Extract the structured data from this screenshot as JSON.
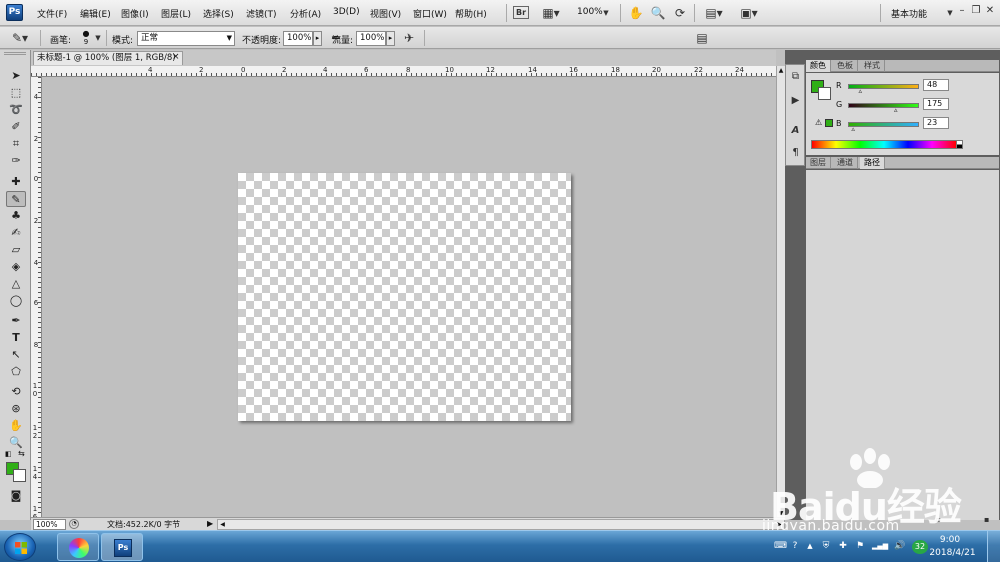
{
  "app": {
    "logo": "Ps"
  },
  "menu": [
    "文件(F)",
    "编辑(E)",
    "图像(I)",
    "图层(L)",
    "选择(S)",
    "滤镜(T)",
    "分析(A)",
    "3D(D)",
    "视图(V)",
    "窗口(W)",
    "帮助(H)"
  ],
  "appbar": {
    "zoom": "100%",
    "br_label": "Br",
    "workspace": "基本功能"
  },
  "options": {
    "brush_label": "画笔:",
    "brush_size": "9",
    "mode_label": "模式:",
    "mode_value": "正常",
    "opacity_label": "不透明度:",
    "opacity_value": "100%",
    "flow_label": "流量:",
    "flow_value": "100%"
  },
  "document": {
    "tab_title": "未标题-1 @ 100% (图层 1, RGB/8)",
    "tab_close": "×",
    "zoom": "100%",
    "doc_info": "文档:452.2K/0 字节"
  },
  "rulers": {
    "top": [
      "4",
      "2",
      "0",
      "2",
      "4",
      "6",
      "8",
      "10",
      "12",
      "14",
      "16",
      "18",
      "20",
      "22",
      "24"
    ],
    "left": [
      "4",
      "2",
      "0",
      "2",
      "4",
      "6",
      "8",
      "1 0",
      "1 2",
      "1 4",
      "1 6"
    ]
  },
  "color_panel": {
    "tabs": [
      "颜色",
      "色板",
      "样式"
    ],
    "channels": [
      {
        "label": "R",
        "value": "48",
        "fraction": 0.19
      },
      {
        "label": "G",
        "value": "175",
        "fraction": 0.69
      },
      {
        "label": "B",
        "value": "23",
        "fraction": 0.09
      }
    ],
    "foreground": "#30af17",
    "background": "#ffffff"
  },
  "layers_panel": {
    "tabs": [
      "图层",
      "通道",
      "路径"
    ]
  },
  "watermark": {
    "logo": "Baidu经验",
    "url": "jingyan.baidu.com"
  },
  "taskbar": {
    "ps_label": "Ps",
    "time": "9:00",
    "date": "2018/4/21",
    "badge": "32"
  },
  "icons": {
    "tools": [
      "move-icon",
      "marquee-icon",
      "lasso-icon",
      "quick-select-icon",
      "crop-icon",
      "eyedropper-icon",
      "spot-heal-icon",
      "brush-icon",
      "clone-stamp-icon",
      "history-brush-icon",
      "eraser-icon",
      "paint-bucket-icon",
      "blur-icon",
      "dodge-icon",
      "pen-icon",
      "type-icon",
      "path-select-icon",
      "shape-icon",
      "3d-rotate-icon",
      "3d-orbit-icon",
      "hand-icon",
      "zoom-icon"
    ]
  }
}
